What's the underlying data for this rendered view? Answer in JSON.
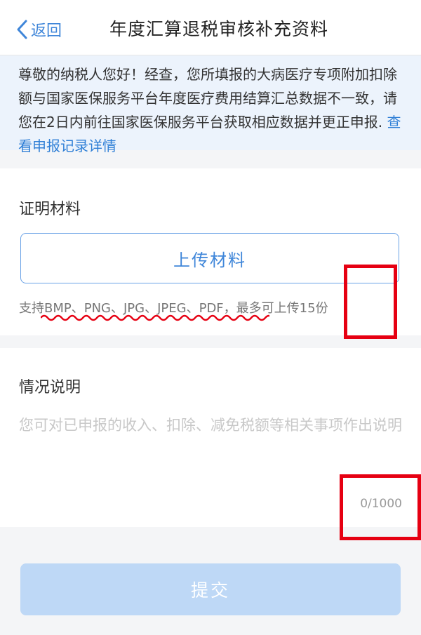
{
  "header": {
    "back_label": "返回",
    "title": "年度汇算退税审核补充资料"
  },
  "notice": {
    "text": "尊敬的纳税人您好！经查，您所填报的大病医疗专项附加扣除额与国家医保服务平台年度医疗费用结算汇总数据不一致，请您在2日内前往国家医保服务平台获取相应数据并更正申报.",
    "link_text": "查看申报记录详情"
  },
  "materials": {
    "title": "证明材料",
    "upload_label": "上传材料",
    "formats_text": "支持BMP、PNG、JPG、JPEG、PDF，最多可上传15份"
  },
  "description": {
    "title": "情况说明",
    "placeholder": "您可对已申报的收入、扣除、减免税额等相关事项作出说明",
    "value": "",
    "counter": "0/1000"
  },
  "submit_label": "提交",
  "colors": {
    "accent": "#3f86d9",
    "notice_bg": "#ecf3fc",
    "submit_disabled": "#bed8f6",
    "annotation_red": "#e60012"
  }
}
